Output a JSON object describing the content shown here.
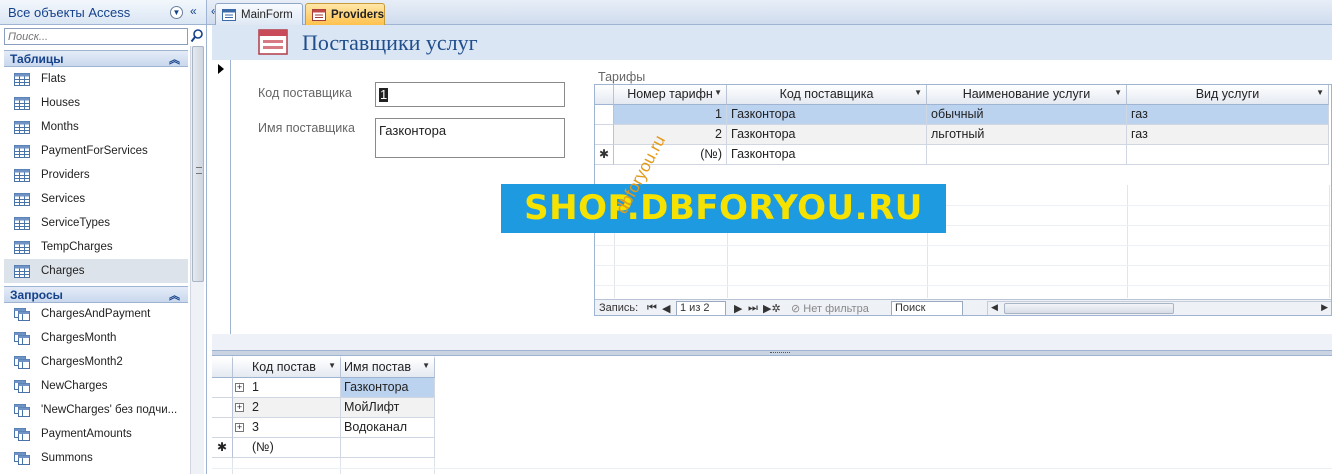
{
  "nav": {
    "title": "Все объекты Access",
    "search_placeholder": "Поиск...",
    "groups": [
      {
        "label": "Таблицы",
        "items": [
          "Flats",
          "Houses",
          "Months",
          "PaymentForServices",
          "Providers",
          "Services",
          "ServiceTypes",
          "TempCharges",
          "Charges"
        ]
      },
      {
        "label": "Запросы",
        "items": [
          "ChargesAndPayment",
          "ChargesMonth",
          "ChargesMonth2",
          "NewCharges",
          "'NewCharges' без подчи...",
          "PaymentAmounts",
          "Summons"
        ]
      }
    ]
  },
  "tabs": [
    {
      "label": "MainForm"
    },
    {
      "label": "Providers"
    }
  ],
  "form": {
    "title": "Поставщики услуг",
    "code_label": "Код поставщика",
    "code_value": "1",
    "name_label": "Имя поставщика",
    "name_value": "Газконтора"
  },
  "subform": {
    "label": "Тарифы",
    "columns": [
      "Номер тарифн",
      "Код поставщика",
      "Наименование услуги",
      "Вид услуги"
    ],
    "rows": [
      [
        "1",
        "Газконтора",
        "обычный",
        "газ"
      ],
      [
        "2",
        "Газконтора",
        "льготный",
        "газ"
      ],
      [
        "(№)",
        "Газконтора",
        "",
        ""
      ]
    ],
    "nav": {
      "record_label": "Запись:",
      "position": "1 из 2",
      "filter": "Нет фильтра",
      "search": "Поиск"
    }
  },
  "datasheet": {
    "columns": [
      "Код постав",
      "Имя постав"
    ],
    "rows": [
      [
        "1",
        "Газконтора"
      ],
      [
        "2",
        "МойЛифт"
      ],
      [
        "3",
        "Водоканал"
      ],
      [
        "(№)",
        ""
      ]
    ]
  },
  "watermark": {
    "banner": "SHOP.DBFORYOU.RU",
    "diagonal": "dbforyou.ru"
  },
  "colors": {
    "accent": "#15428b",
    "active_tab": "#ffc14d",
    "selection": "#bcd3f0",
    "banner_bg": "#1e9be0",
    "banner_text": "#f6e200"
  }
}
